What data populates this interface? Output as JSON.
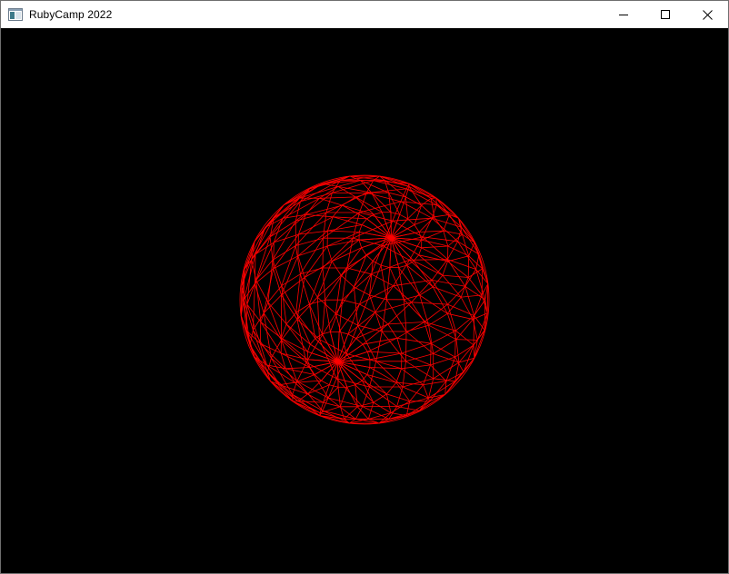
{
  "window": {
    "title": "RubyCamp 2022",
    "icon": "app-window-icon"
  },
  "controls": {
    "minimize_icon": "minimize-icon",
    "maximize_icon": "maximize-icon",
    "close_icon": "close-icon"
  },
  "scene": {
    "background": "#000000",
    "wire_color": "#ff0000",
    "object": "wireframe-sphere"
  }
}
